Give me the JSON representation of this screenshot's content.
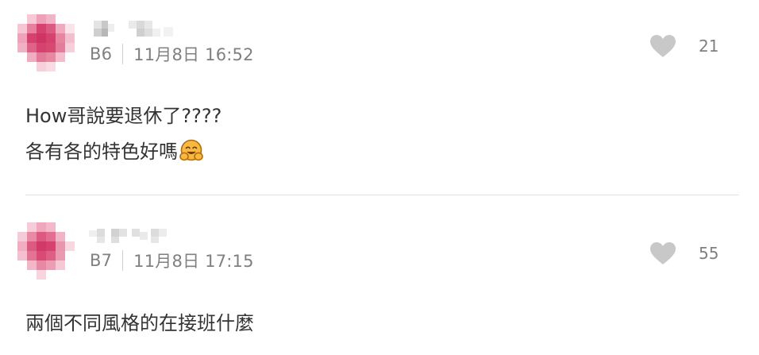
{
  "comments": [
    {
      "floor": "B6",
      "timestamp": "11月8日 16:52",
      "like_count": "21",
      "lines": [
        "How哥說要退休了????",
        "各有各的特色好嗎"
      ],
      "emoji": "hugging-face",
      "avatar_color": "#d6426f"
    },
    {
      "floor": "B7",
      "timestamp": "11月8日 17:15",
      "like_count": "55",
      "lines": [
        "兩個不同風格的在接班什麼"
      ],
      "avatar_color": "#d6426f"
    }
  ],
  "colors": {
    "meta_text": "#808080",
    "body_text": "#333333",
    "heart": "#c8c8c8",
    "divider": "#e2e2e2"
  }
}
